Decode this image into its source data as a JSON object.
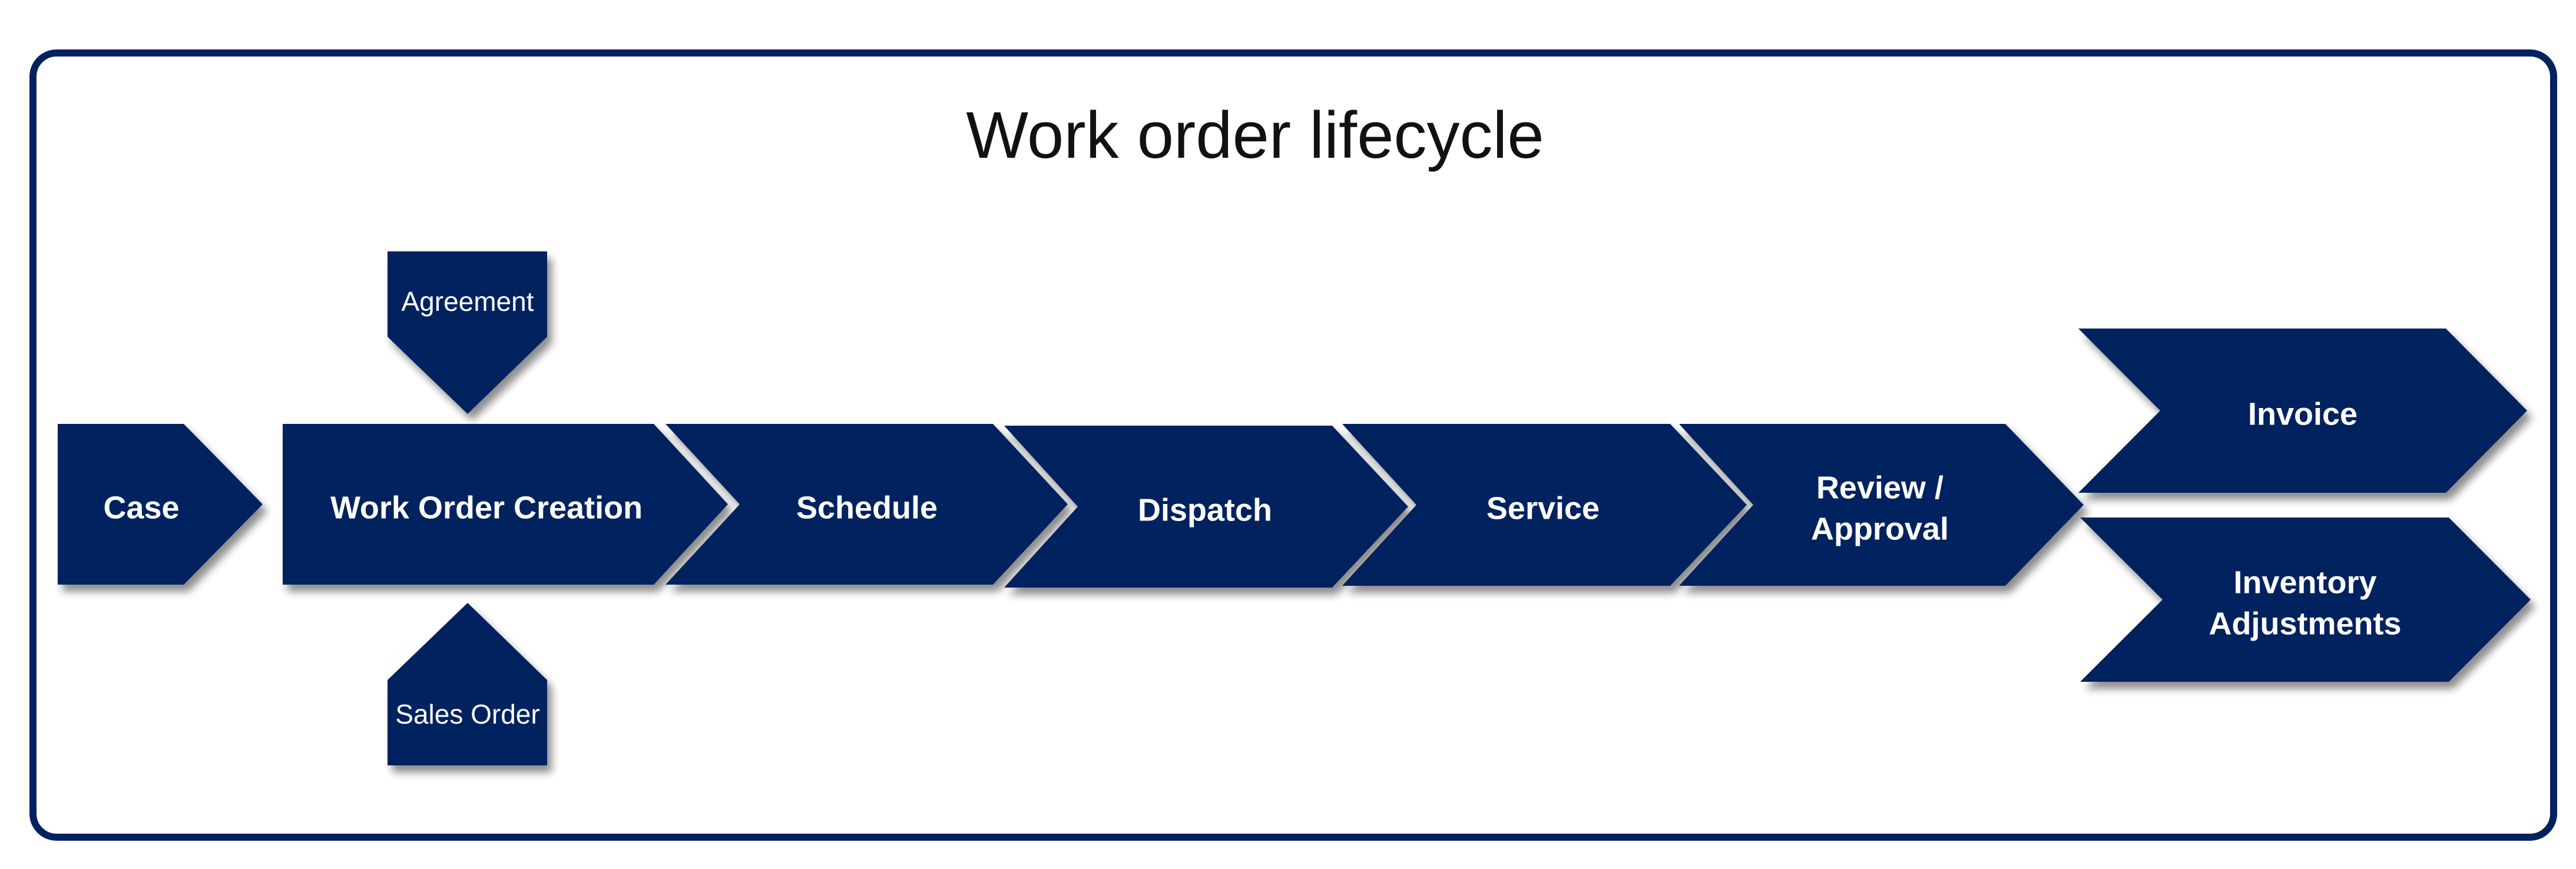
{
  "title": "Work order lifecycle",
  "colors": {
    "shape": "#03215f",
    "border": "#03215f",
    "text": "#ffffff"
  },
  "steps": [
    {
      "id": "case",
      "label": [
        "Case"
      ]
    },
    {
      "id": "work-order-creation",
      "label": [
        "Work Order Creation"
      ]
    },
    {
      "id": "schedule",
      "label": [
        "Schedule"
      ]
    },
    {
      "id": "dispatch",
      "label": [
        "Dispatch"
      ]
    },
    {
      "id": "service",
      "label": [
        "Service"
      ]
    },
    {
      "id": "review-approval",
      "label": [
        "Review /",
        "Approval"
      ]
    }
  ],
  "inputs": [
    {
      "id": "agreement",
      "label": "Agreement",
      "direction": "down"
    },
    {
      "id": "sales-order",
      "label": "Sales Order",
      "direction": "up"
    }
  ],
  "outcomes": [
    {
      "id": "invoice",
      "label": [
        "Invoice"
      ]
    },
    {
      "id": "inventory-adjustments",
      "label": [
        "Inventory",
        "Adjustments"
      ]
    }
  ]
}
